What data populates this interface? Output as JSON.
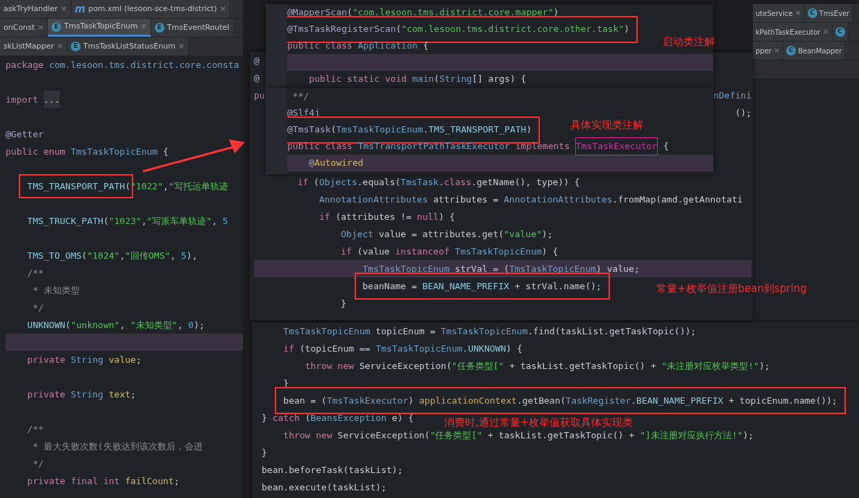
{
  "left_editor": {
    "tab_rows": [
      [
        {
          "label": "askTryHandler",
          "selected": false,
          "close": "×"
        },
        {
          "label": "pom.xml (lesoon-sce-tms-district)",
          "selected": false,
          "close": "×",
          "icon": {
            "kind": "maven",
            "letter": "m"
          }
        }
      ],
      [
        {
          "label": "onConst",
          "selected": false,
          "close": "×"
        },
        {
          "label": "TmsTaskTopicEnum",
          "selected": true,
          "close": "×",
          "icon": {
            "kind": "circle",
            "letter": "E"
          }
        },
        {
          "label": "TmsEventRouteI",
          "selected": false,
          "icon": {
            "kind": "circle",
            "letter": "E"
          }
        }
      ],
      [
        {
          "label": "skListMapper",
          "selected": false,
          "close": "×"
        },
        {
          "label": "TmsTaskListStatusEnum",
          "selected": false,
          "close": "×",
          "icon": {
            "kind": "circle",
            "letter": "E"
          }
        }
      ]
    ],
    "lines": [
      {
        "current": false,
        "tokens": [
          {
            "kind": "kw",
            "text": "package "
          },
          {
            "kind": "type",
            "text": "com.lesoon.tms.district.core.consta"
          }
        ]
      },
      {
        "current": false
      },
      {
        "current": false,
        "tokens": [
          {
            "kind": "kw",
            "text": "import "
          },
          {
            "kind": "fold",
            "text": "..."
          }
        ]
      },
      {
        "current": false
      },
      {
        "current": false,
        "tokens": [
          {
            "kind": "anno",
            "text": "@Getter"
          }
        ]
      },
      {
        "current": false,
        "tokens": [
          {
            "kind": "kw",
            "text": "public enum "
          },
          {
            "kind": "type",
            "text": "TmsTaskTopicEnum"
          },
          {
            "kind": "plain",
            "text": " {"
          }
        ]
      },
      {
        "current": false
      },
      {
        "current": false,
        "tokens": [
          {
            "kind": "const",
            "text": "    TMS_TRANSPORT_PATH",
            "boxed": true
          },
          {
            "kind": "plain",
            "text": "("
          },
          {
            "kind": "str",
            "text": "\"1022\""
          },
          {
            "kind": "plain",
            "text": ","
          },
          {
            "kind": "str",
            "text": "\"写托运单轨迹"
          }
        ]
      },
      {
        "current": false
      },
      {
        "current": false,
        "tokens": [
          {
            "kind": "const",
            "text": "    TMS_TRUCK_PATH"
          },
          {
            "kind": "plain",
            "text": "("
          },
          {
            "kind": "str",
            "text": "\"1023\""
          },
          {
            "kind": "plain",
            "text": ","
          },
          {
            "kind": "str",
            "text": "\"写派车单轨迹\""
          },
          {
            "kind": "plain",
            "text": ", "
          },
          {
            "kind": "num",
            "text": "5"
          }
        ]
      },
      {
        "current": false
      },
      {
        "current": false,
        "tokens": [
          {
            "kind": "const",
            "text": "    TMS_TO_OMS"
          },
          {
            "kind": "plain",
            "text": "("
          },
          {
            "kind": "str",
            "text": "\"1024\""
          },
          {
            "kind": "plain",
            "text": ","
          },
          {
            "kind": "str",
            "text": "\"回传OMS\""
          },
          {
            "kind": "plain",
            "text": ", "
          },
          {
            "kind": "num",
            "text": "5"
          },
          {
            "kind": "plain",
            "text": "),"
          }
        ]
      },
      {
        "current": false,
        "tokens": [
          {
            "kind": "comment",
            "text": "    /**"
          }
        ]
      },
      {
        "current": false,
        "tokens": [
          {
            "kind": "comment",
            "text": "     * 未知类型"
          }
        ]
      },
      {
        "current": false,
        "tokens": [
          {
            "kind": "comment",
            "text": "     */"
          }
        ]
      },
      {
        "current": false,
        "tokens": [
          {
            "kind": "const",
            "text": "    UNKNOWN"
          },
          {
            "kind": "plain",
            "text": "("
          },
          {
            "kind": "str",
            "text": "\"unknown\""
          },
          {
            "kind": "plain",
            "text": ", "
          },
          {
            "kind": "str",
            "text": "\"未知类型\""
          },
          {
            "kind": "plain",
            "text": ", "
          },
          {
            "kind": "num",
            "text": "0"
          },
          {
            "kind": "plain",
            "text": ");"
          }
        ]
      },
      {
        "current": true
      },
      {
        "current": false,
        "tokens": [
          {
            "kind": "kw",
            "text": "    private "
          },
          {
            "kind": "type",
            "text": "String "
          },
          {
            "kind": "field",
            "text": "value"
          },
          {
            "kind": "plain",
            "text": ";"
          }
        ]
      },
      {
        "current": false
      },
      {
        "current": false,
        "tokens": [
          {
            "kind": "kw",
            "text": "    private "
          },
          {
            "kind": "type",
            "text": "String "
          },
          {
            "kind": "field",
            "text": "text"
          },
          {
            "kind": "plain",
            "text": ";"
          }
        ]
      },
      {
        "current": false
      },
      {
        "current": false,
        "tokens": [
          {
            "kind": "comment",
            "text": "    /**"
          }
        ]
      },
      {
        "current": false,
        "tokens": [
          {
            "kind": "comment",
            "text": "     * 最大失败次数(失败达到该次数后，会进"
          }
        ]
      },
      {
        "current": false,
        "tokens": [
          {
            "kind": "comment",
            "text": "     */"
          }
        ]
      },
      {
        "current": false,
        "tokens": [
          {
            "kind": "kw",
            "text": "    private final int "
          },
          {
            "kind": "field",
            "text": "failCount"
          },
          {
            "kind": "plain",
            "text": ";"
          }
        ]
      }
    ]
  },
  "right_window": {
    "tab_rows": [
      [
        {
          "label": "uteService",
          "selected": false,
          "close": "×"
        },
        {
          "label": "TmsEver",
          "selected": false,
          "icon": {
            "kind": "circle",
            "letter": "C"
          }
        }
      ],
      [
        {
          "label": "kPathTaskExecutor",
          "selected": false,
          "close": "×"
        },
        {
          "selected": false,
          "icon": {
            "kind": "circle",
            "letter": "C"
          }
        }
      ],
      [
        {
          "label": "pper",
          "selected": false,
          "close": "×"
        },
        {
          "label": "BeanMapper",
          "selected": false,
          "icon": {
            "kind": "circle",
            "letter": "C"
          }
        }
      ]
    ]
  },
  "register_window": {
    "lines": [
      {
        "current": false,
        "tokens": [
          {
            "kind": "anno",
            "text": "@"
          }
        ]
      },
      {
        "current": false,
        "tokens": [
          {
            "kind": "anno",
            "text": "@"
          }
        ]
      },
      {
        "current": false,
        "tokens": [
          {
            "kind": "kw",
            "text": "pu"
          }
        ],
        "tail": [
          {
            "kind": "type",
            "text": "nDefini"
          }
        ]
      },
      {
        "current": false,
        "tail": [
          {
            "kind": "plain",
            "text": "();"
          }
        ]
      },
      {
        "current": false
      },
      {
        "current": false
      },
      {
        "current": false
      },
      {
        "current": false,
        "tokens": [
          {
            "kind": "kw",
            "text": "        if "
          },
          {
            "kind": "plain",
            "text": "("
          },
          {
            "kind": "type",
            "text": "Objects"
          },
          {
            "kind": "plain",
            "text": ".equals("
          },
          {
            "kind": "type",
            "text": "TmsTask"
          },
          {
            "kind": "plain",
            "text": "."
          },
          {
            "kind": "kw",
            "text": "class"
          },
          {
            "kind": "plain",
            "text": ".getName(), type)) {"
          }
        ]
      },
      {
        "current": false,
        "tokens": [
          {
            "kind": "type",
            "text": "            AnnotationAttributes"
          },
          {
            "kind": "plain",
            "text": " attributes = "
          },
          {
            "kind": "type",
            "text": "AnnotationAttributes"
          },
          {
            "kind": "plain",
            "text": ".fromMap(amd.getAnnotati"
          }
        ]
      },
      {
        "current": false,
        "tokens": [
          {
            "kind": "kw",
            "text": "            if "
          },
          {
            "kind": "plain",
            "text": "(attributes != "
          },
          {
            "kind": "kw",
            "text": "null"
          },
          {
            "kind": "plain",
            "text": ") {"
          }
        ]
      },
      {
        "current": false,
        "tokens": [
          {
            "kind": "type",
            "text": "                Object"
          },
          {
            "kind": "plain",
            "text": " value = attributes.get("
          },
          {
            "kind": "str",
            "text": "\"value\""
          },
          {
            "kind": "plain",
            "text": ");"
          }
        ]
      },
      {
        "current": false,
        "tokens": [
          {
            "kind": "kw",
            "text": "                if "
          },
          {
            "kind": "plain",
            "text": "(value "
          },
          {
            "kind": "kw",
            "text": "instanceof "
          },
          {
            "kind": "type",
            "text": "TmsTaskTopicEnum"
          },
          {
            "kind": "plain",
            "text": ") {"
          }
        ]
      },
      {
        "current": true,
        "tokens": [
          {
            "kind": "type",
            "text": "                    TmsTaskTopicEnum"
          },
          {
            "kind": "plain",
            "text": " strVal = ("
          },
          {
            "kind": "type",
            "text": "TmsTaskTopicEnum"
          },
          {
            "kind": "plain",
            "text": ") value;"
          }
        ]
      },
      {
        "current": false,
        "boxed": true,
        "tokens": [
          {
            "kind": "plain",
            "text": "                    beanName = "
          },
          {
            "kind": "const",
            "text": "BEAN_NAME_PREFIX"
          },
          {
            "kind": "plain",
            "text": " + strVal.name();"
          }
        ]
      },
      {
        "current": false,
        "tokens": [
          {
            "kind": "plain",
            "text": "                }"
          }
        ]
      }
    ]
  },
  "application_window": {
    "lines": [
      {
        "current": false,
        "tokens": [
          {
            "kind": "anno",
            "text": "@MapperScan"
          },
          {
            "kind": "plain",
            "text": "("
          },
          {
            "kind": "str",
            "text": "\"com.lesoon.tms.district.core.mapper\""
          },
          {
            "kind": "plain",
            "text": ")"
          }
        ]
      },
      {
        "current": false,
        "boxed": true,
        "tokens": [
          {
            "kind": "anno",
            "text": "@TmsTaskRegisterScan"
          },
          {
            "kind": "plain",
            "text": "("
          },
          {
            "kind": "str",
            "text": "\"com.lesoon.tms.district.core.other.task\""
          },
          {
            "kind": "plain",
            "text": ")"
          }
        ]
      },
      {
        "current": false,
        "tokens": [
          {
            "kind": "kw",
            "text": "public class "
          },
          {
            "kind": "type",
            "text": "Application"
          },
          {
            "kind": "plain",
            "text": " {"
          }
        ]
      },
      {
        "current": true
      },
      {
        "current": false,
        "tokens": [
          {
            "kind": "kw",
            "text": "    public static void "
          },
          {
            "kind": "type",
            "text": "main"
          },
          {
            "kind": "plain",
            "text": "("
          },
          {
            "kind": "type",
            "text": "String"
          },
          {
            "kind": "plain",
            "text": "[] args) {"
          }
        ]
      }
    ]
  },
  "executor_window": {
    "lines": [
      {
        "current": false,
        "tokens": [
          {
            "kind": "comment",
            "text": " **/"
          }
        ]
      },
      {
        "current": false,
        "tokens": [
          {
            "kind": "anno",
            "text": "@Slf4j"
          }
        ]
      },
      {
        "current": false,
        "boxed": true,
        "tokens": [
          {
            "kind": "anno",
            "text": "@TmsTask"
          },
          {
            "kind": "plain",
            "text": "("
          },
          {
            "kind": "type",
            "text": "TmsTaskTopicEnum"
          },
          {
            "kind": "plain",
            "text": "."
          },
          {
            "kind": "const",
            "text": "TMS_TRANSPORT_PATH"
          },
          {
            "kind": "plain",
            "text": ")"
          }
        ]
      },
      {
        "current": false,
        "tokens": [
          {
            "kind": "kw",
            "text": "public class "
          },
          {
            "kind": "type",
            "text": "TmsTransportPathTaskExecutor "
          },
          {
            "kind": "kw",
            "text": "implements "
          },
          {
            "kind": "iface",
            "text": "TmsTaskExecutor",
            "highlighted": true
          },
          {
            "kind": "plain",
            "text": " {"
          }
        ]
      },
      {
        "current": true,
        "tokens": [
          {
            "kind": "anno",
            "text": "    @"
          },
          {
            "kind": "field",
            "text": "Autowired"
          }
        ]
      }
    ]
  },
  "consumer_window": {
    "lines": [
      {
        "current": false,
        "tokens": [
          {
            "kind": "type",
            "text": "    TmsTaskTopicEnum"
          },
          {
            "kind": "plain",
            "text": " topicEnum = "
          },
          {
            "kind": "type",
            "text": "TmsTaskTopicEnum"
          },
          {
            "kind": "plain",
            "text": ".find(taskList.getTaskTopic());"
          }
        ]
      },
      {
        "current": false,
        "tokens": [
          {
            "kind": "kw",
            "text": "    if "
          },
          {
            "kind": "plain",
            "text": "(topicEnum == "
          },
          {
            "kind": "type",
            "text": "TmsTaskTopicEnum"
          },
          {
            "kind": "plain",
            "text": "."
          },
          {
            "kind": "const",
            "text": "UNKNOWN"
          },
          {
            "kind": "plain",
            "text": ") {"
          }
        ]
      },
      {
        "current": false,
        "tokens": [
          {
            "kind": "kw",
            "text": "        throw new "
          },
          {
            "kind": "plain",
            "text": "ServiceException("
          },
          {
            "kind": "str",
            "text": "\"任务类型[\""
          },
          {
            "kind": "plain",
            "text": " + taskList.getTaskTopic() + "
          },
          {
            "kind": "str",
            "text": "\"未注册对应枚举类型!\""
          },
          {
            "kind": "plain",
            "text": ");"
          }
        ]
      },
      {
        "current": false,
        "tokens": [
          {
            "kind": "plain",
            "text": "    }"
          }
        ]
      },
      {
        "current": false,
        "boxed": true,
        "tokens": [
          {
            "kind": "plain",
            "text": "    bean = ("
          },
          {
            "kind": "type",
            "text": "TmsTaskExecutor"
          },
          {
            "kind": "plain",
            "text": ") "
          },
          {
            "kind": "method",
            "text": "applicationContext"
          },
          {
            "kind": "plain",
            "text": ".getBean("
          },
          {
            "kind": "type",
            "text": "TaskRegister"
          },
          {
            "kind": "plain",
            "text": "."
          },
          {
            "kind": "const",
            "text": "BEAN_NAME_PREFIX"
          },
          {
            "kind": "plain",
            "text": " + topicEnum.name());"
          }
        ]
      },
      {
        "current": false,
        "tokens": [
          {
            "kind": "plain",
            "text": "} "
          },
          {
            "kind": "kw",
            "text": "catch "
          },
          {
            "kind": "plain",
            "text": "("
          },
          {
            "kind": "type",
            "text": "BeansException"
          },
          {
            "kind": "plain",
            "text": " e) {"
          }
        ]
      },
      {
        "current": false,
        "tokens": [
          {
            "kind": "kw",
            "text": "    throw new "
          },
          {
            "kind": "plain",
            "text": "ServiceException("
          },
          {
            "kind": "str",
            "text": "\"任务类型[\""
          },
          {
            "kind": "plain",
            "text": " + taskList.getTaskTopic() + "
          },
          {
            "kind": "str",
            "text": "\"]未注册对应执行方法!\""
          },
          {
            "kind": "plain",
            "text": ");"
          }
        ]
      },
      {
        "current": false,
        "tokens": [
          {
            "kind": "plain",
            "text": "}"
          }
        ]
      },
      {
        "current": false,
        "tokens": [
          {
            "kind": "plain",
            "text": "bean.beforeTask(taskList);"
          }
        ]
      },
      {
        "current": false,
        "tokens": [
          {
            "kind": "plain",
            "text": "bean.execute(taskList);"
          }
        ]
      }
    ]
  },
  "annotations": [
    "启动类注解",
    "具体实现类注解",
    "常量+枚举值注册bean到spring",
    "消费时,通过常量+枚举值获取具体实现类"
  ]
}
